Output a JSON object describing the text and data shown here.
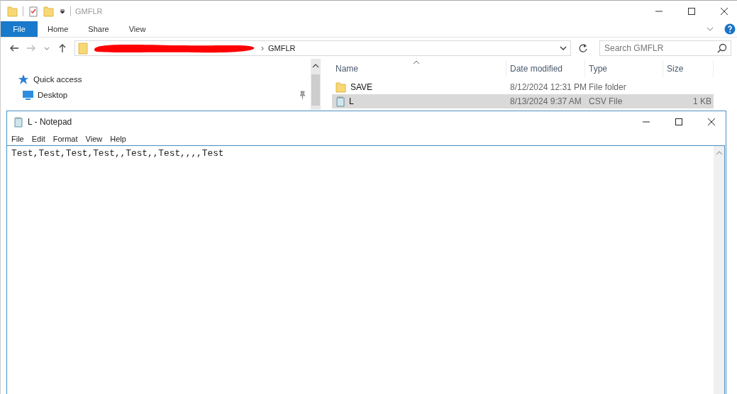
{
  "explorer": {
    "title": "GMFLR",
    "ribbon_tabs": [
      {
        "label": "File",
        "selected": true
      },
      {
        "label": "Home",
        "selected": false
      },
      {
        "label": "Share",
        "selected": false
      },
      {
        "label": "View",
        "selected": false
      }
    ],
    "address": {
      "redacted": true,
      "separator": "›",
      "location": "GMFLR"
    },
    "search": {
      "placeholder": "Search GMFLR"
    },
    "nav": [
      {
        "label": "Quick access",
        "kind": "star",
        "pinned": false
      },
      {
        "label": "Desktop",
        "kind": "desktop",
        "pinned": true
      }
    ],
    "columns": [
      "Name",
      "Date modified",
      "Type",
      "Size"
    ],
    "rows": [
      {
        "name": "SAVE",
        "kind": "folder",
        "date": "8/12/2024 12:31 PM",
        "type": "File folder",
        "selected": false
      },
      {
        "name": "L",
        "kind": "file",
        "date": "8/13/2024 9:37 AM",
        "type": "CSV File",
        "size": "1 KB",
        "selected": true
      }
    ]
  },
  "notepad": {
    "title": "L - Notepad",
    "menu": [
      "File",
      "Edit",
      "Format",
      "View",
      "Help"
    ],
    "text": "Test,Test,Test,Test,,Test,,Test,,,,Test"
  }
}
